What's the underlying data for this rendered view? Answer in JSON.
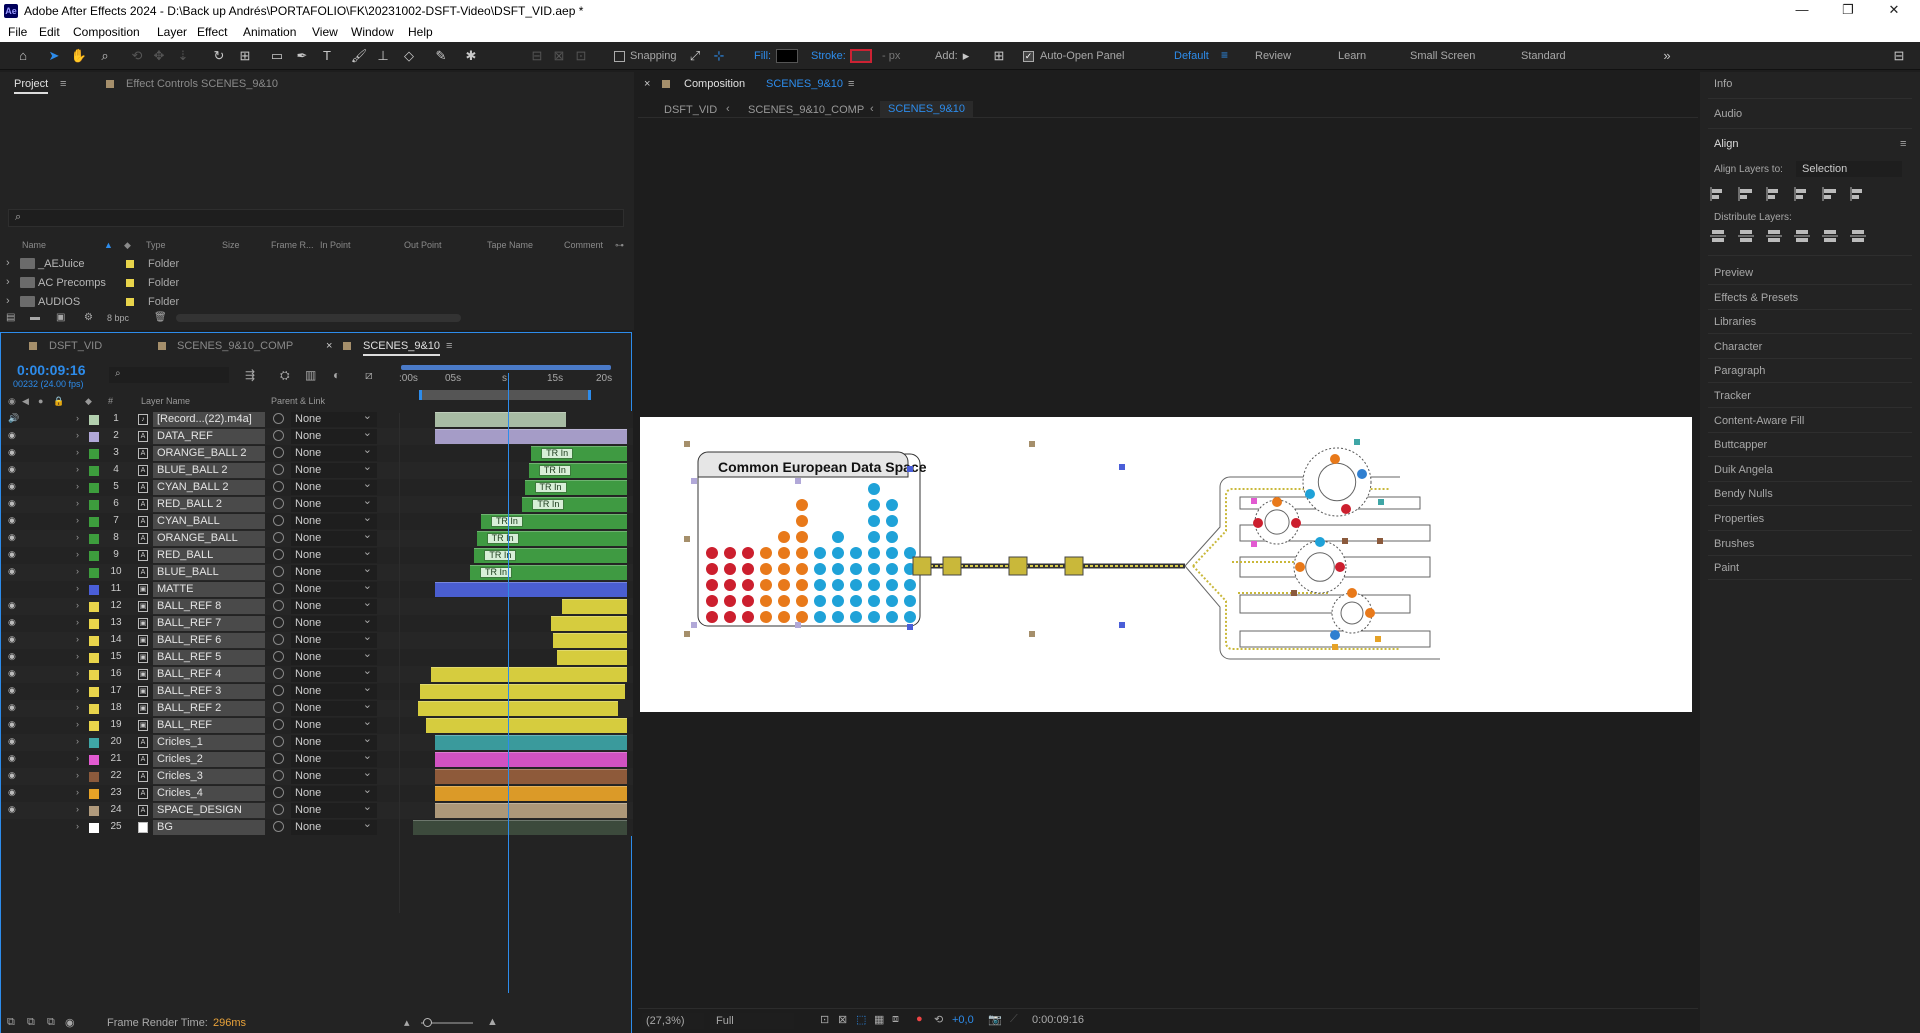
{
  "window": {
    "title": "Adobe After Effects 2024 - D:\\Back up Andrés\\PORTAFOLIO\\FK\\20231002-DSFT-Video\\DSFT_VID.aep *",
    "app_icon": "Ae"
  },
  "menu": [
    "File",
    "Edit",
    "Composition",
    "Layer",
    "Effect",
    "Animation",
    "View",
    "Window",
    "Help"
  ],
  "toolbar": {
    "snapping": "Snapping",
    "fill": "Fill:",
    "stroke": "Stroke:",
    "px": "- px",
    "add": "Add:",
    "auto_open": "Auto-Open Panel",
    "workspaces": [
      "Default",
      "Review",
      "Learn",
      "Small Screen",
      "Standard"
    ],
    "active_workspace": "Default"
  },
  "project": {
    "tab": "Project",
    "effect_tab": "Effect Controls SCENES_9&10",
    "search_placeholder": "",
    "columns": [
      "Name",
      "Type",
      "Size",
      "Frame R...",
      "In Point",
      "Out Point",
      "Tape Name",
      "Comment"
    ],
    "items": [
      {
        "name": "_AEJuice",
        "type": "Folder"
      },
      {
        "name": "AC Precomps",
        "type": "Folder"
      },
      {
        "name": "AUDIOS",
        "type": "Folder"
      }
    ],
    "bpc": "8 bpc"
  },
  "timeline": {
    "tabs": [
      "DSFT_VID",
      "SCENES_9&10_COMP",
      "SCENES_9&10"
    ],
    "active_tab": "SCENES_9&10",
    "timecode": "0:00:09:16",
    "frame_info": "00232 (24.00 fps)",
    "col_layer": "Layer Name",
    "col_parent": "Parent & Link",
    "col_num": "#",
    "ruler": [
      ":00s",
      "05s",
      "s",
      "15s",
      "20s"
    ],
    "playhead_fraction": 0.455,
    "parent_value": "None",
    "layers": [
      {
        "n": "1",
        "name": "[Record...(22).m4a]",
        "color": "#b2cfae",
        "icon": "audio",
        "bar": "#a8bca4",
        "start": 0.12,
        "end": 0.72,
        "bar2": "#8d9e8a"
      },
      {
        "n": "2",
        "name": "DATA_REF",
        "color": "#b1a8d8",
        "icon": "A",
        "bar": "#a59cc7",
        "start": 0.12,
        "end": 1.0
      },
      {
        "n": "3",
        "name": "ORANGE_BALL 2",
        "color": "#3d9d3d",
        "icon": "A",
        "bar": "#3f9a42",
        "start": 0.56,
        "end": 1.0,
        "tag": "TR In"
      },
      {
        "n": "4",
        "name": "BLUE_BALL 2",
        "color": "#3d9d3d",
        "icon": "A",
        "bar": "#3f9a42",
        "start": 0.55,
        "end": 1.0,
        "tag": "TR In"
      },
      {
        "n": "5",
        "name": "CYAN_BALL 2",
        "color": "#3d9d3d",
        "icon": "A",
        "bar": "#3f9a42",
        "start": 0.53,
        "end": 1.0,
        "tag": "TR In"
      },
      {
        "n": "6",
        "name": "RED_BALL 2",
        "color": "#3d9d3d",
        "icon": "A",
        "bar": "#3f9a42",
        "start": 0.52,
        "end": 1.0,
        "tag": "TR In"
      },
      {
        "n": "7",
        "name": "CYAN_BALL",
        "color": "#3d9d3d",
        "icon": "A",
        "bar": "#3f9a42",
        "start": 0.33,
        "end": 1.0,
        "tag": "TR In"
      },
      {
        "n": "8",
        "name": "ORANGE_BALL",
        "color": "#3d9d3d",
        "icon": "A",
        "bar": "#3f9a42",
        "start": 0.31,
        "end": 1.0,
        "tag": "TR In"
      },
      {
        "n": "9",
        "name": "RED_BALL",
        "color": "#3d9d3d",
        "icon": "A",
        "bar": "#3f9a42",
        "start": 0.3,
        "end": 1.0,
        "tag": "TR In"
      },
      {
        "n": "10",
        "name": "BLUE_BALL",
        "color": "#3d9d3d",
        "icon": "A",
        "bar": "#3f9a42",
        "start": 0.28,
        "end": 1.0,
        "tag": "TR In"
      },
      {
        "n": "11",
        "name": "MATTE",
        "color": "#4a5ed8",
        "icon": "matte",
        "bar": "#4a5ed0",
        "start": 0.12,
        "end": 1.0
      },
      {
        "n": "12",
        "name": "BALL_REF 8",
        "color": "#e8d44b",
        "icon": "comp",
        "bar": "#d6cc3e",
        "start": 0.7,
        "end": 1.0
      },
      {
        "n": "13",
        "name": "BALL_REF 7",
        "color": "#e8d44b",
        "icon": "comp",
        "bar": "#d6cc3e",
        "start": 0.65,
        "end": 1.0
      },
      {
        "n": "14",
        "name": "BALL_REF 6",
        "color": "#e8d44b",
        "icon": "comp",
        "bar": "#d6cc3e",
        "start": 0.66,
        "end": 1.0
      },
      {
        "n": "15",
        "name": "BALL_REF 5",
        "color": "#e8d44b",
        "icon": "comp",
        "bar": "#d6cc3e",
        "start": 0.68,
        "end": 1.0
      },
      {
        "n": "16",
        "name": "BALL_REF 4",
        "color": "#e8d44b",
        "icon": "comp",
        "bar": "#d6cc3e",
        "start": 0.1,
        "end": 1.0
      },
      {
        "n": "17",
        "name": "BALL_REF 3",
        "color": "#e8d44b",
        "icon": "comp",
        "bar": "#d6cc3e",
        "start": 0.05,
        "end": 0.99
      },
      {
        "n": "18",
        "name": "BALL_REF 2",
        "color": "#e8d44b",
        "icon": "comp",
        "bar": "#d6cc3e",
        "start": 0.04,
        "end": 0.96
      },
      {
        "n": "19",
        "name": "BALL_REF",
        "color": "#e8d44b",
        "icon": "comp",
        "bar": "#d6cc3e",
        "start": 0.08,
        "end": 1.0
      },
      {
        "n": "20",
        "name": "Cricles_1",
        "color": "#3fa6a6",
        "icon": "A",
        "bar": "#3a9a9c",
        "start": 0.12,
        "end": 1.0
      },
      {
        "n": "21",
        "name": "Cricles_2",
        "color": "#e25ad1",
        "icon": "A",
        "bar": "#d152c2",
        "start": 0.12,
        "end": 1.0
      },
      {
        "n": "22",
        "name": "Cricles_3",
        "color": "#8b5a3c",
        "icon": "A",
        "bar": "#8e5a3a",
        "start": 0.12,
        "end": 1.0
      },
      {
        "n": "23",
        "name": "Cricles_4",
        "color": "#e6a226",
        "icon": "A",
        "bar": "#db9a28",
        "start": 0.12,
        "end": 1.0
      },
      {
        "n": "24",
        "name": "SPACE_DESIGN",
        "color": "#b09a7c",
        "icon": "A",
        "bar": "#ad9879",
        "start": 0.12,
        "end": 1.0
      },
      {
        "n": "25",
        "name": "BG",
        "color": "#ffffff",
        "icon": "solid",
        "bar": "#3c4a3c",
        "start": 0.02,
        "end": 1.0
      }
    ],
    "render_time_label": "Frame Render Time:",
    "render_time_value": "296ms"
  },
  "composition": {
    "panel_title": "Composition",
    "comp_name": "SCENES_9&10",
    "breadcrumbs": [
      "DSFT_VID",
      "SCENES_9&10_COMP",
      "SCENES_9&10"
    ],
    "canvas_title": "Common European Data Space",
    "zoom": "(27,3%)",
    "resolution": "Full",
    "exposure": "+0,0",
    "timecode": "0:00:09:16"
  },
  "right_panel": {
    "items_top": [
      "Info",
      "Audio"
    ],
    "align_title": "Align",
    "align_to_label": "Align Layers to:",
    "align_to_value": "Selection",
    "distribute_label": "Distribute Layers:",
    "items": [
      "Preview",
      "Effects & Presets",
      "Libraries",
      "Character",
      "Paragraph",
      "Tracker",
      "Content-Aware Fill",
      "Buttcapper",
      "Duik Angela",
      "Bendy Nulls",
      "Properties",
      "Brushes",
      "Paint"
    ]
  },
  "colors": {
    "accent": "#2d8ceb",
    "red": "#cc1f2e",
    "orange": "#e8791a",
    "cyan": "#1fa2d8",
    "blue": "#2f7fd0",
    "olive": "#c9b83a"
  }
}
